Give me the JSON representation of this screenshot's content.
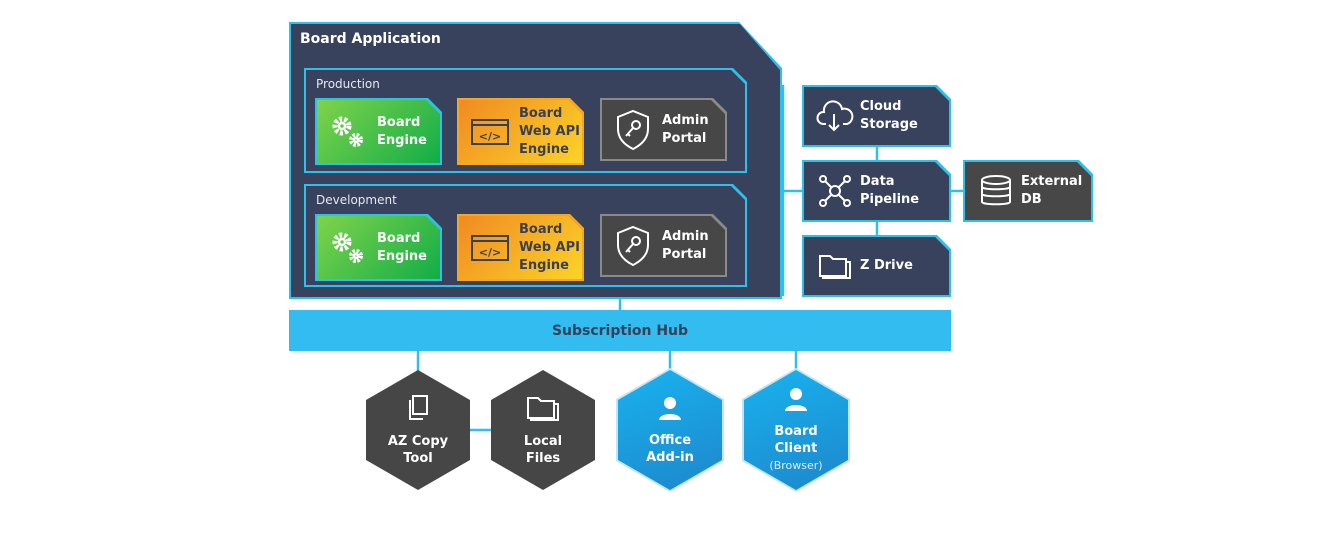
{
  "board_app": {
    "title": "Board Application",
    "environments": [
      {
        "label": "Production",
        "nodes": [
          {
            "label": "Board Engine",
            "icon": "gears-icon"
          },
          {
            "label": "Board Web API Engine",
            "icon": "code-window-icon"
          },
          {
            "label": "Admin Portal",
            "icon": "shield-key-icon"
          }
        ]
      },
      {
        "label": "Development",
        "nodes": [
          {
            "label": "Board Engine",
            "icon": "gears-icon"
          },
          {
            "label": "Board Web API Engine",
            "icon": "code-window-icon"
          },
          {
            "label": "Admin Portal",
            "icon": "shield-key-icon"
          }
        ]
      }
    ]
  },
  "services": [
    {
      "label": "Cloud Storage",
      "icon": "cloud-download-icon"
    },
    {
      "label": "Data Pipeline",
      "icon": "network-hub-icon"
    },
    {
      "label": "Z Drive",
      "icon": "folder-icon"
    },
    {
      "label": "External DB",
      "icon": "database-icon"
    }
  ],
  "hub": {
    "label": "Subscription Hub"
  },
  "clients": [
    {
      "label": "AZ Copy Tool",
      "icon": "copy-files-icon"
    },
    {
      "label": "Local Files",
      "icon": "folder-icon"
    },
    {
      "label": "Office Add-in",
      "icon": "user-icon"
    },
    {
      "label": "Board Client",
      "sub": "(Browser)",
      "icon": "user-icon"
    }
  ],
  "colors": {
    "navy": "#38425c",
    "cyan": "#2fc0ea",
    "hub": "#33bcef",
    "green": "#12ad48",
    "orange": "#f5a623",
    "gray": "#474747",
    "blue": "#1d9ee0"
  }
}
